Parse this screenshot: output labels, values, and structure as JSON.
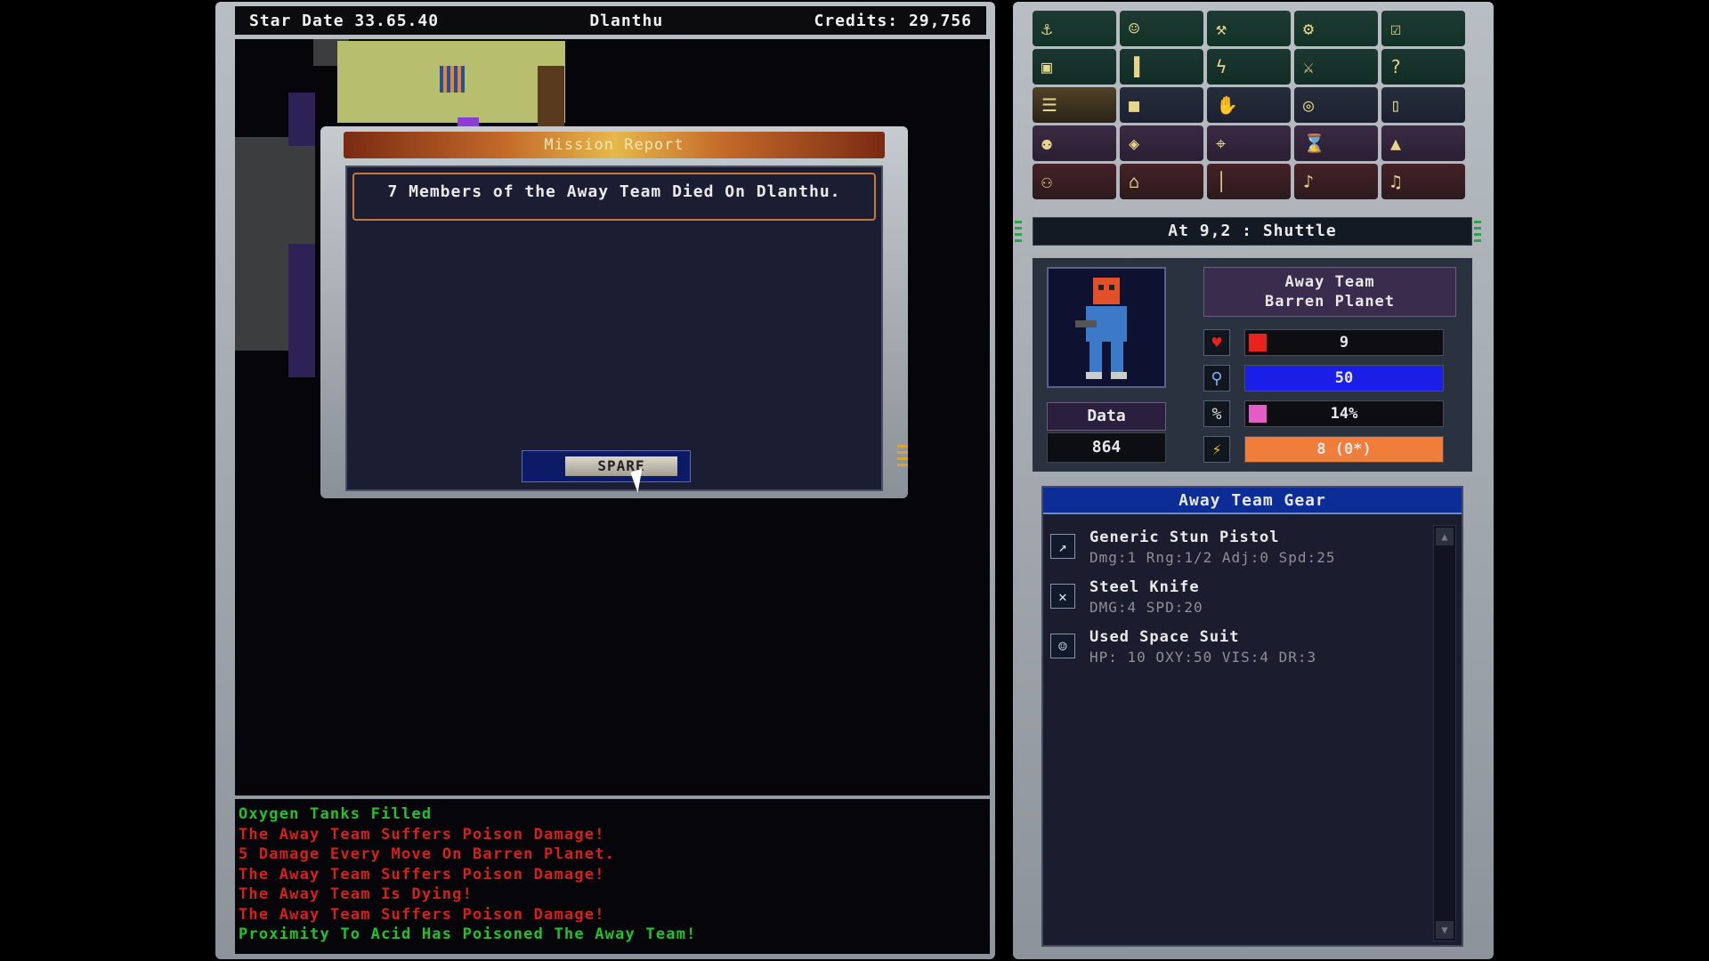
{
  "header": {
    "star_date": "Star Date 33.65.40",
    "planet": "Dlanthu",
    "credits": "Credits: 29,756"
  },
  "dialog": {
    "title": "Mission Report",
    "message": "7 Members of the Away Team Died On Dlanthu.",
    "button_label": "SPARE"
  },
  "log": [
    {
      "text": "Oxygen Tanks Filled",
      "color": "green"
    },
    {
      "text": "The Away Team Suffers Poison Damage!",
      "color": "red"
    },
    {
      "text": "5 Damage Every Move On Barren Planet.",
      "color": "red"
    },
    {
      "text": "The Away Team Suffers Poison Damage!",
      "color": "red"
    },
    {
      "text": "The Away Team Is Dying!",
      "color": "red"
    },
    {
      "text": "The Away Team Suffers Poison Damage!",
      "color": "red"
    },
    {
      "text": "Proximity To Acid Has Poisoned The Away Team!",
      "color": "green"
    }
  ],
  "toolbar": {
    "icons": [
      [
        "anchor-icon",
        "crew-icon",
        "wrench-icon",
        "gear-icon",
        "checkbox-icon"
      ],
      [
        "cargo-icon",
        "chart-icon",
        "lightning-icon",
        "sword-icon",
        "help-icon"
      ],
      [
        "crew-list-icon",
        "box-icon",
        "hand-icon",
        "binoculars-icon",
        "document-icon"
      ],
      [
        "robot-icon",
        "scanner-icon",
        "target-icon",
        "hourglass-icon",
        "ship-icon"
      ],
      [
        "team-icon",
        "lock-icon",
        "torch-icon",
        "sound-icon",
        "music-icon"
      ]
    ]
  },
  "location": "At 9,2 : Shuttle",
  "status": {
    "team_line1": "Away Team",
    "team_line2": "Barren Planet",
    "data_label": "Data",
    "data_value": "864",
    "health": "9",
    "oxygen": "50",
    "percent": "14%",
    "ammo": "8 (0*)",
    "colors": {
      "health": "#e8221c",
      "oxygen": "#1b1ee6",
      "percent": "#e65cc6",
      "ammo": "#f07d3a"
    }
  },
  "gear": {
    "title": "Away Team Gear",
    "items": [
      {
        "name": "Generic Stun Pistol",
        "stats": "Dmg:1 Rng:1/2 Adj:0 Spd:25",
        "icon": "pistol-icon"
      },
      {
        "name": "Steel Knife",
        "stats": "DMG:4 SPD:20",
        "icon": "knife-icon"
      },
      {
        "name": "Used Space Suit",
        "stats": "HP: 10 OXY:50 VIS:4 DR:3",
        "icon": "spacesuit-icon"
      }
    ]
  }
}
